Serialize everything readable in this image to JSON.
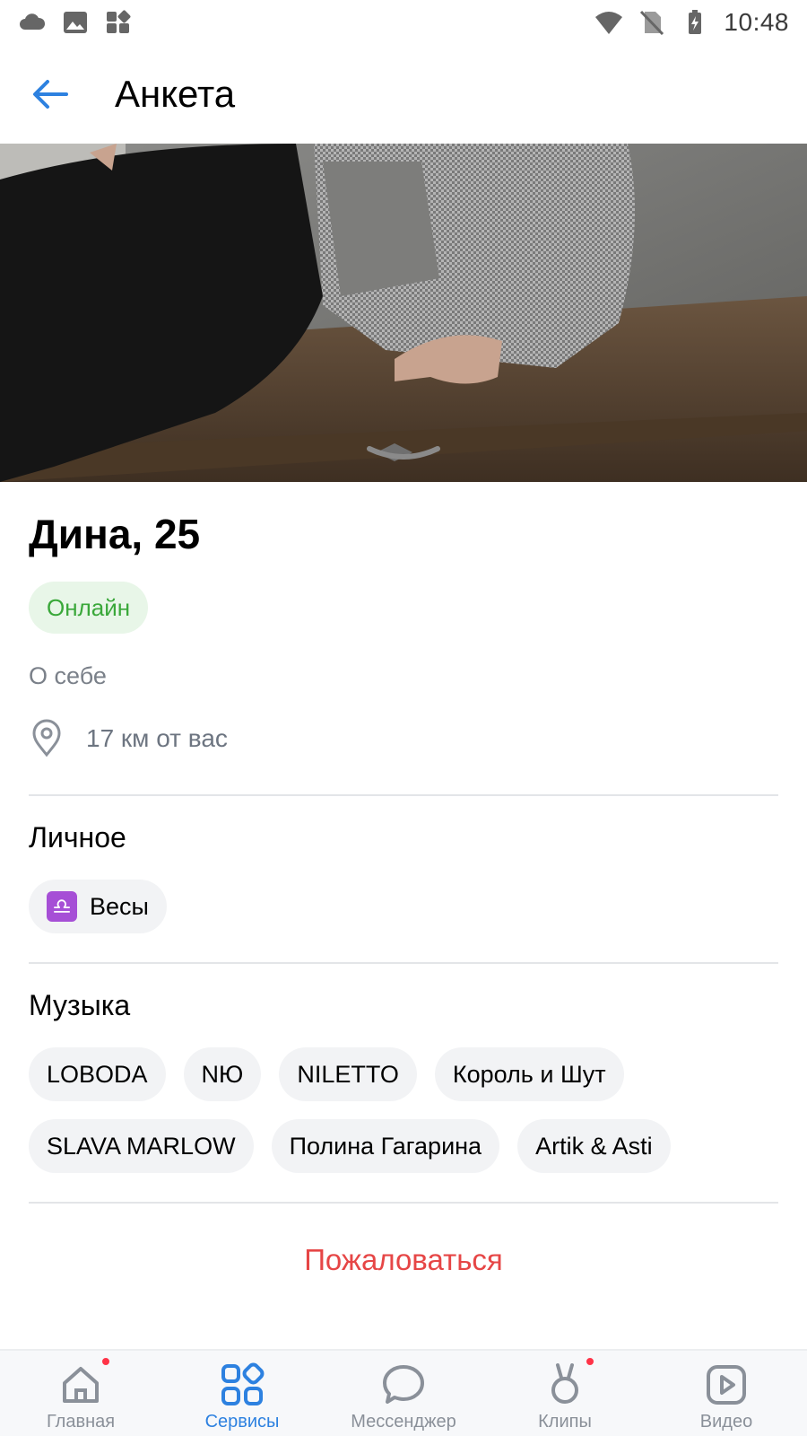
{
  "status_bar": {
    "time": "10:48"
  },
  "app_bar": {
    "title": "Анкета"
  },
  "profile": {
    "name_age": "Дина, 25",
    "status": "Онлайн",
    "about_label": "О себе",
    "distance": "17 км от вас"
  },
  "personal": {
    "title": "Личное",
    "zodiac": {
      "symbol": "♎",
      "label": "Весы"
    }
  },
  "music": {
    "title": "Музыка",
    "row1": [
      "LOBODA",
      "NЮ",
      "NILETTO",
      "Король и Шут"
    ],
    "row2": [
      "SLAVA MARLOW",
      "Полина Гагарина",
      "Artik & Asti"
    ]
  },
  "report_label": "Пожаловаться",
  "bottom_nav": {
    "items": [
      {
        "label": "Главная",
        "icon": "home-icon",
        "badge": true
      },
      {
        "label": "Сервисы",
        "icon": "services-icon",
        "active": true
      },
      {
        "label": "Мессенджер",
        "icon": "messenger-icon"
      },
      {
        "label": "Клипы",
        "icon": "clips-icon",
        "badge": true
      },
      {
        "label": "Видео",
        "icon": "video-icon"
      }
    ]
  },
  "colors": {
    "accent": "#2d81e0",
    "online_bg": "#e8f6e8",
    "online_text": "#3aa83a",
    "report": "#e64646",
    "badge": "#ff3347"
  }
}
